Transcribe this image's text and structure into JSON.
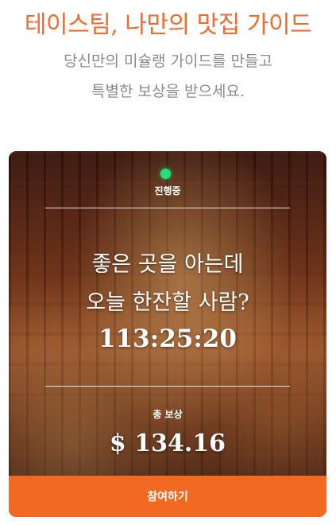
{
  "header": {
    "headline": "테이스팀, 나만의 맛집 가이드",
    "subline_1": "당신만의 미슐랭 가이드를 만들고",
    "subline_2": "특별한 보상을 받으세요."
  },
  "card": {
    "status": "진행중",
    "title_line_1": "좋은 곳을 아는데",
    "title_line_2": "오늘 한잔할 사람?",
    "countdown": "113:25:20",
    "reward_label": "총 보상",
    "reward_amount": "$ 134.16",
    "join_label": "참여하기",
    "background_image": "bar-interior-photo"
  },
  "colors": {
    "accent": "#f26a21",
    "headline": "#f26a2e",
    "subtext": "#8a8a8a",
    "status_dot": "#22e07a"
  }
}
